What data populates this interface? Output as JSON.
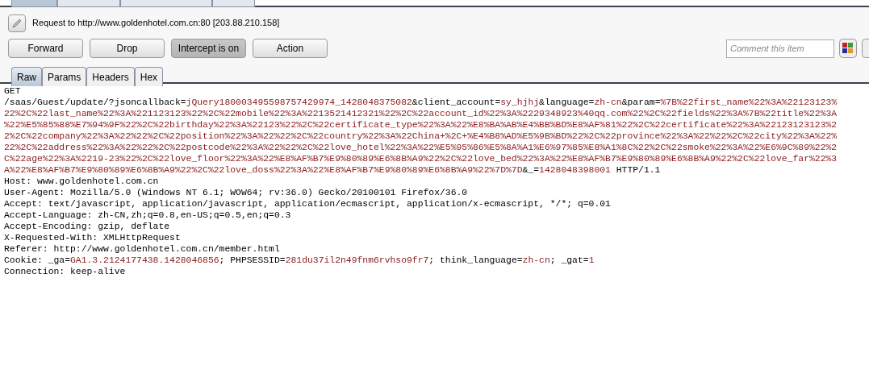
{
  "top_tabs": [
    {
      "selected": true
    },
    {
      "selected": false
    },
    {
      "selected": false
    },
    {
      "selected": false
    }
  ],
  "request_title": "Request to http://www.goldenhotel.com.cn:80  [203.88.210.158]",
  "buttons": [
    {
      "label": "Forward",
      "pressed": false
    },
    {
      "label": "Drop",
      "pressed": false
    },
    {
      "label": "Intercept is on",
      "pressed": true
    },
    {
      "label": "Action",
      "pressed": false
    }
  ],
  "comment": {
    "placeholder": "Comment this item"
  },
  "view_tabs": [
    {
      "label": "Raw",
      "selected": true
    },
    {
      "label": "Params",
      "selected": false
    },
    {
      "label": "Headers",
      "selected": false
    },
    {
      "label": "Hex",
      "selected": false
    }
  ],
  "request_lines": [
    [
      {
        "text": "GET",
        "kind": "plain"
      }
    ],
    [
      {
        "text": "/saas/Guest/update/?jsoncallback=",
        "kind": "plain"
      },
      {
        "text": "jQuery180003495598757429974_1428048375082",
        "kind": "value"
      },
      {
        "text": "&client_account=",
        "kind": "plain"
      },
      {
        "text": "sy_hjhj",
        "kind": "value"
      },
      {
        "text": "&language=",
        "kind": "plain"
      },
      {
        "text": "zh-cn",
        "kind": "value"
      },
      {
        "text": "&param=",
        "kind": "plain"
      },
      {
        "text": "%7B%22first_name%22%3A%22123123%",
        "kind": "value"
      }
    ],
    [
      {
        "text": "22%2C%22last_name%22%3A%221123123%22%2C%22mobile%22%3A%2213521412321%22%2C%22account_id%22%3A%2229348923%40qq.com%22%2C%22fields%22%3A%7B%22title%22%3A",
        "kind": "value"
      }
    ],
    [
      {
        "text": "%22%E5%85%88%E7%94%9F%22%2C%22birthday%22%3A%22123%22%2C%22certificate_type%22%3A%22%E8%BA%AB%E4%BB%BD%E8%AF%81%22%2C%22certificate%22%3A%22123123123%2",
        "kind": "value"
      }
    ],
    [
      {
        "text": "2%2C%22company%22%3A%22%22%2C%22position%22%3A%22%22%2C%22country%22%3A%22China+%2C+%E4%B8%AD%E5%9B%BD%22%2C%22province%22%3A%22%22%2C%22city%22%3A%22%",
        "kind": "value"
      }
    ],
    [
      {
        "text": "22%2C%22address%22%3A%22%22%2C%22postcode%22%3A%22%22%2C%22love_hotel%22%3A%22%E5%95%86%E5%8A%A1%E6%97%85%E8%A1%8C%22%2C%22smoke%22%3A%22%E6%9C%89%22%2",
        "kind": "value"
      }
    ],
    [
      {
        "text": "C%22age%22%3A%2219-23%22%2C%22love_floor%22%3A%22%E8%AF%B7%E9%80%89%E6%8B%A9%22%2C%22love_bed%22%3A%22%E8%AF%B7%E9%80%89%E6%8B%A9%22%2C%22love_far%22%3",
        "kind": "value"
      }
    ],
    [
      {
        "text": "A%22%E8%AF%B7%E9%80%89%E6%8B%A9%22%2C%22love_doss%22%3A%22%E8%AF%B7%E9%80%89%E6%8B%A9%22%7D%7D",
        "kind": "value"
      },
      {
        "text": "&_=",
        "kind": "plain"
      },
      {
        "text": "1428048398001",
        "kind": "value"
      },
      {
        "text": " HTTP/1.1",
        "kind": "plain"
      }
    ],
    [
      {
        "text": "Host: www.goldenhotel.com.cn",
        "kind": "plain"
      }
    ],
    [
      {
        "text": "User-Agent: Mozilla/5.0 (Windows NT 6.1; WOW64; rv:36.0) Gecko/20100101 Firefox/36.0",
        "kind": "plain"
      }
    ],
    [
      {
        "text": "Accept: text/javascript, application/javascript, application/ecmascript, application/x-ecmascript, */*; q=0.01",
        "kind": "plain"
      }
    ],
    [
      {
        "text": "Accept-Language: zh-CN,zh;q=0.8,en-US;q=0.5,en;q=0.3",
        "kind": "plain"
      }
    ],
    [
      {
        "text": "Accept-Encoding: gzip, deflate",
        "kind": "plain"
      }
    ],
    [
      {
        "text": "X-Requested-With: XMLHttpRequest",
        "kind": "plain"
      }
    ],
    [
      {
        "text": "Referer: http://www.goldenhotel.com.cn/member.html",
        "kind": "plain"
      }
    ],
    [
      {
        "text": "Cookie: _ga=",
        "kind": "plain"
      },
      {
        "text": "GA1.3.2124177438.1428046856",
        "kind": "value"
      },
      {
        "text": "; PHPSESSID=",
        "kind": "plain"
      },
      {
        "text": "281du37il2n49fnm6rvhso9fr7",
        "kind": "value"
      },
      {
        "text": "; think_language=",
        "kind": "plain"
      },
      {
        "text": "zh-cn",
        "kind": "value"
      },
      {
        "text": "; _gat=",
        "kind": "plain"
      },
      {
        "text": "1",
        "kind": "value"
      }
    ],
    [
      {
        "text": "Connection: keep-alive",
        "kind": "plain"
      }
    ]
  ]
}
